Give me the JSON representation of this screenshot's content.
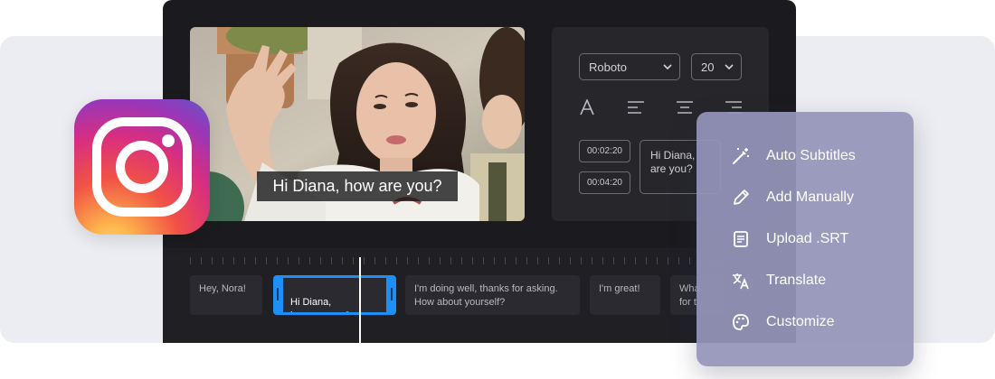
{
  "video": {
    "caption": "Hi Diana, how are you?"
  },
  "settings": {
    "font_select": "Roboto",
    "size_select": "20",
    "start_time": "00:02:20",
    "end_time": "00:04:20",
    "subtitle_text": "Hi Diana,\nare you?"
  },
  "timeline": {
    "clips": [
      "Hey, Nora!",
      "Hi Diana,\nhow are you?",
      "I'm doing well, thanks for asking.\nHow about yourself?",
      "I'm great!",
      "Wha\nfor t"
    ]
  },
  "menu": {
    "items": [
      {
        "label": "Auto Subtitles",
        "icon": "magic-wand-icon"
      },
      {
        "label": "Add Manually",
        "icon": "pencil-icon"
      },
      {
        "label": "Upload .SRT",
        "icon": "document-icon"
      },
      {
        "label": "Translate",
        "icon": "translate-icon"
      },
      {
        "label": "Customize",
        "icon": "palette-icon"
      }
    ]
  },
  "colors": {
    "accent": "#1e8ff6",
    "editor_bg": "#1b1b1f",
    "menu_bg": "#9495ba"
  }
}
